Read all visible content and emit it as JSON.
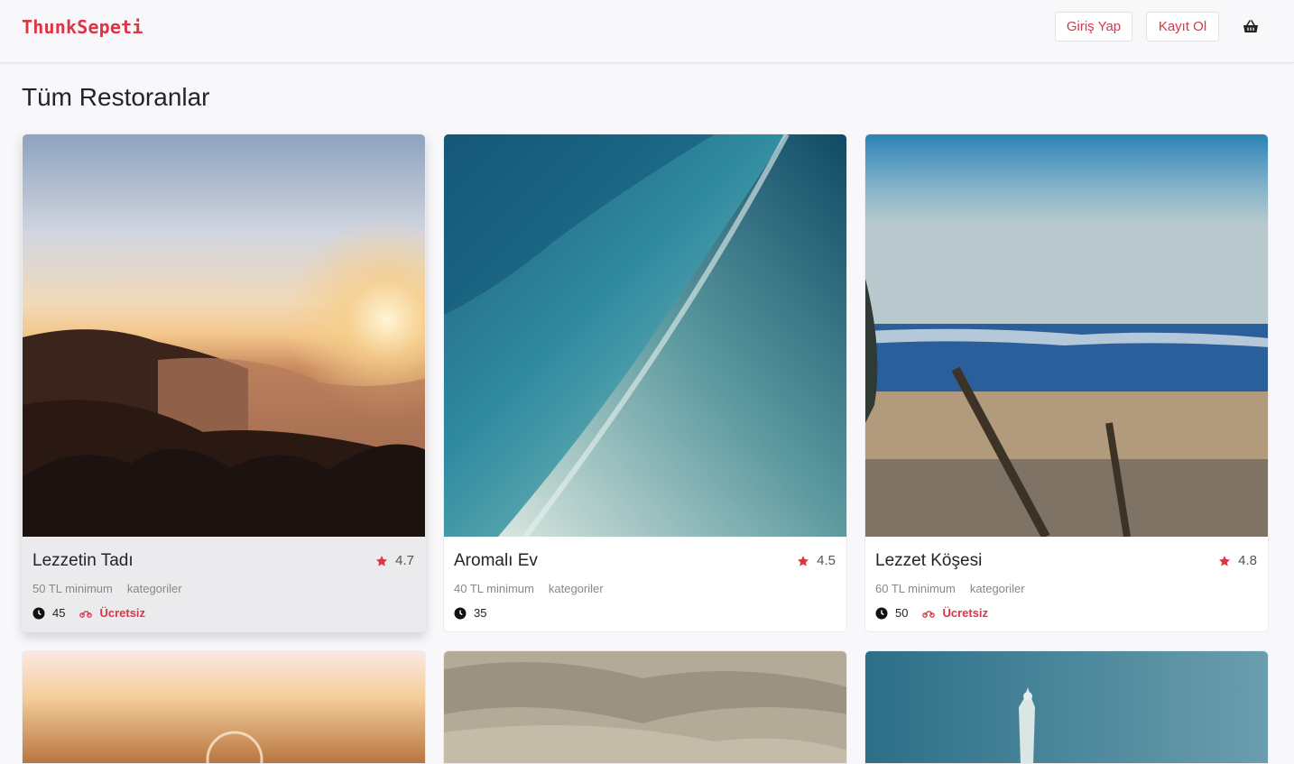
{
  "brand": "ThunkSepeti",
  "nav": {
    "login_label": "Giriş Yap",
    "register_label": "Kayıt Ol",
    "cart_icon": "basket-icon"
  },
  "page_title": "Tüm Restoranlar",
  "colors": {
    "accent": "#dc3545"
  },
  "restaurants": [
    {
      "name": "Lezzetin Tadı",
      "rating": "4.7",
      "minimum": "50 TL minimum",
      "categories": "kategoriler",
      "delivery_time": "45",
      "delivery_fee": "Ücretsiz"
    },
    {
      "name": "Aromalı Ev",
      "rating": "4.5",
      "minimum": "40 TL minimum",
      "categories": "kategoriler",
      "delivery_time": "35",
      "delivery_fee": ""
    },
    {
      "name": "Lezzet Köşesi",
      "rating": "4.8",
      "minimum": "60 TL minimum",
      "categories": "kategoriler",
      "delivery_time": "50",
      "delivery_fee": "Ücretsiz"
    }
  ]
}
